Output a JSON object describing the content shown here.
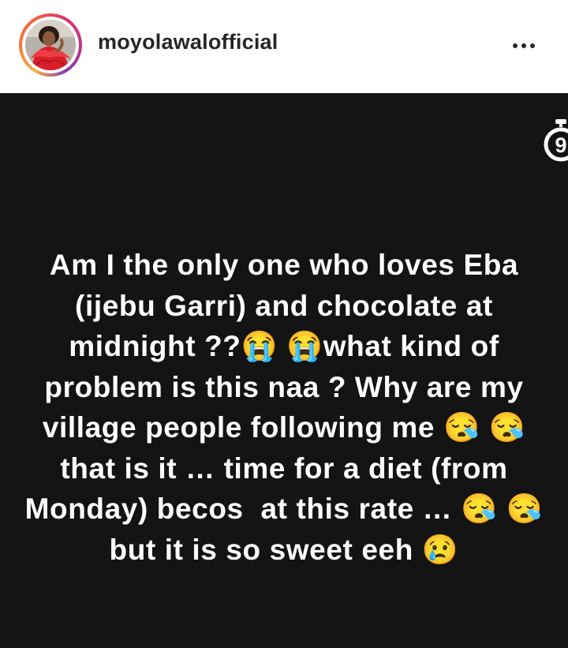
{
  "header": {
    "username": "moyolawalofficial",
    "avatar_icon": "profile-photo-avatar",
    "more_icon": "more-options-icon"
  },
  "story": {
    "timer_icon": "timer-icon",
    "timer_digit": "9",
    "text_lines": [
      "Am I the only one who loves Eba",
      "(ijebu Garri) and chocolate at",
      "midnight ??😭 😭what kind of",
      "problem is this naa ? Why are my",
      "village people following me 😪 😪",
      "that is it … time for a diet (from",
      "Monday) becos  at this rate … 😪 😪",
      "but it is so sweet eeh 😢"
    ],
    "background_color": "#0b0b0b",
    "text_color": "#ffffff"
  }
}
